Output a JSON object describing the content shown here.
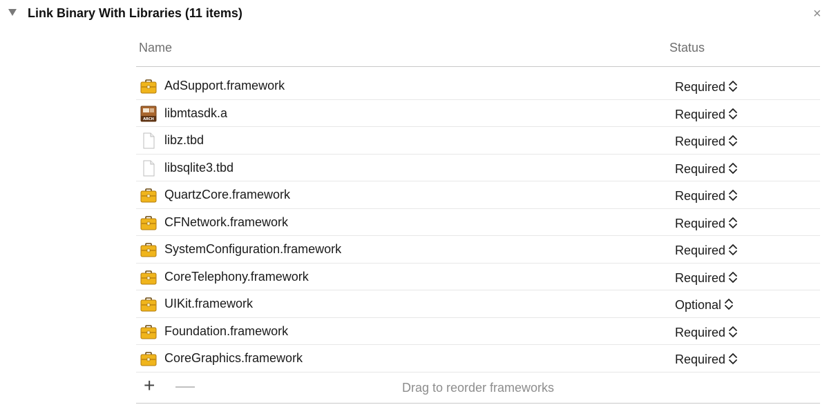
{
  "section": {
    "title": "Link Binary With Libraries (11 items)",
    "close_glyph": "×"
  },
  "table": {
    "headers": {
      "name": "Name",
      "status": "Status"
    },
    "rows": [
      {
        "name": "AdSupport.framework",
        "status": "Required",
        "icon": "toolbox-icon"
      },
      {
        "name": "libmtasdk.a",
        "status": "Required",
        "icon": "archive-icon"
      },
      {
        "name": "libz.tbd",
        "status": "Required",
        "icon": "document-icon"
      },
      {
        "name": "libsqlite3.tbd",
        "status": "Required",
        "icon": "document-icon"
      },
      {
        "name": "QuartzCore.framework",
        "status": "Required",
        "icon": "toolbox-icon"
      },
      {
        "name": "CFNetwork.framework",
        "status": "Required",
        "icon": "toolbox-icon"
      },
      {
        "name": "SystemConfiguration.framework",
        "status": "Required",
        "icon": "toolbox-icon"
      },
      {
        "name": "CoreTelephony.framework",
        "status": "Required",
        "icon": "toolbox-icon"
      },
      {
        "name": "UIKit.framework",
        "status": "Optional",
        "icon": "toolbox-icon"
      },
      {
        "name": "Foundation.framework",
        "status": "Required",
        "icon": "toolbox-icon"
      },
      {
        "name": "CoreGraphics.framework",
        "status": "Required",
        "icon": "toolbox-icon"
      }
    ]
  },
  "footer": {
    "add_glyph": "+",
    "remove_glyph": "—",
    "hint": "Drag to reorder frameworks"
  },
  "colors": {
    "framework_icon": "#f0b51c",
    "archive_icon": "#a9662e"
  }
}
